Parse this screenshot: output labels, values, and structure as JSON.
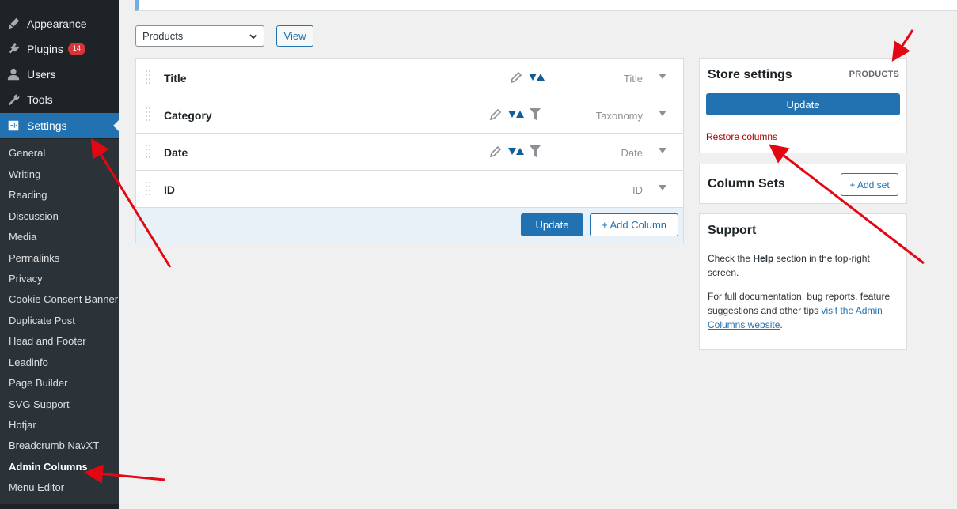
{
  "sidebar": {
    "top_items": [
      {
        "label": "Appearance",
        "icon": "paintbrush-icon"
      },
      {
        "label": "Plugins",
        "icon": "plugin-icon",
        "badge": "14"
      },
      {
        "label": "Users",
        "icon": "user-icon"
      },
      {
        "label": "Tools",
        "icon": "wrench-icon"
      },
      {
        "label": "Settings",
        "icon": "settings-icon",
        "current": true
      }
    ],
    "submenu": [
      "General",
      "Writing",
      "Reading",
      "Discussion",
      "Media",
      "Permalinks",
      "Privacy",
      "Cookie Consent Banner",
      "Duplicate Post",
      "Head and Footer",
      "Leadinfo",
      "Page Builder",
      "SVG Support",
      "Hotjar",
      "Breadcrumb NavXT",
      "Admin Columns",
      "Menu Editor"
    ],
    "current_submenu": "Admin Columns"
  },
  "toolbar": {
    "list_select_value": "Products",
    "view_label": "View"
  },
  "columns": [
    {
      "label": "Title",
      "type": "Title",
      "icons": [
        "edit-icon",
        "sort-icon"
      ]
    },
    {
      "label": "Category",
      "type": "Taxonomy",
      "icons": [
        "edit-icon",
        "sort-icon",
        "filter-icon"
      ]
    },
    {
      "label": "Date",
      "type": "Date",
      "icons": [
        "edit-icon",
        "sort-icon",
        "filter-icon"
      ]
    },
    {
      "label": "ID",
      "type": "ID",
      "icons": []
    }
  ],
  "column_footer": {
    "update_label": "Update",
    "add_column_label": "+ Add Column"
  },
  "store_settings": {
    "title": "Store settings",
    "post_type": "PRODUCTS",
    "update_label": "Update",
    "restore_label": "Restore columns"
  },
  "column_sets": {
    "title": "Column Sets",
    "add_label": "+ Add set"
  },
  "support": {
    "title": "Support",
    "p1_before": "Check the ",
    "p1_bold": "Help",
    "p1_after": " section in the top-right screen.",
    "p2_before": "For full documentation, bug reports, feature suggestions and other tips ",
    "p2_link": "visit the Admin Columns website",
    "p2_after": "."
  },
  "colors": {
    "accent": "#2271b1",
    "sidebar": "#1d2327",
    "submenu": "#2c3338",
    "danger": "#aa0000",
    "annotation_arrow": "#e30613"
  }
}
